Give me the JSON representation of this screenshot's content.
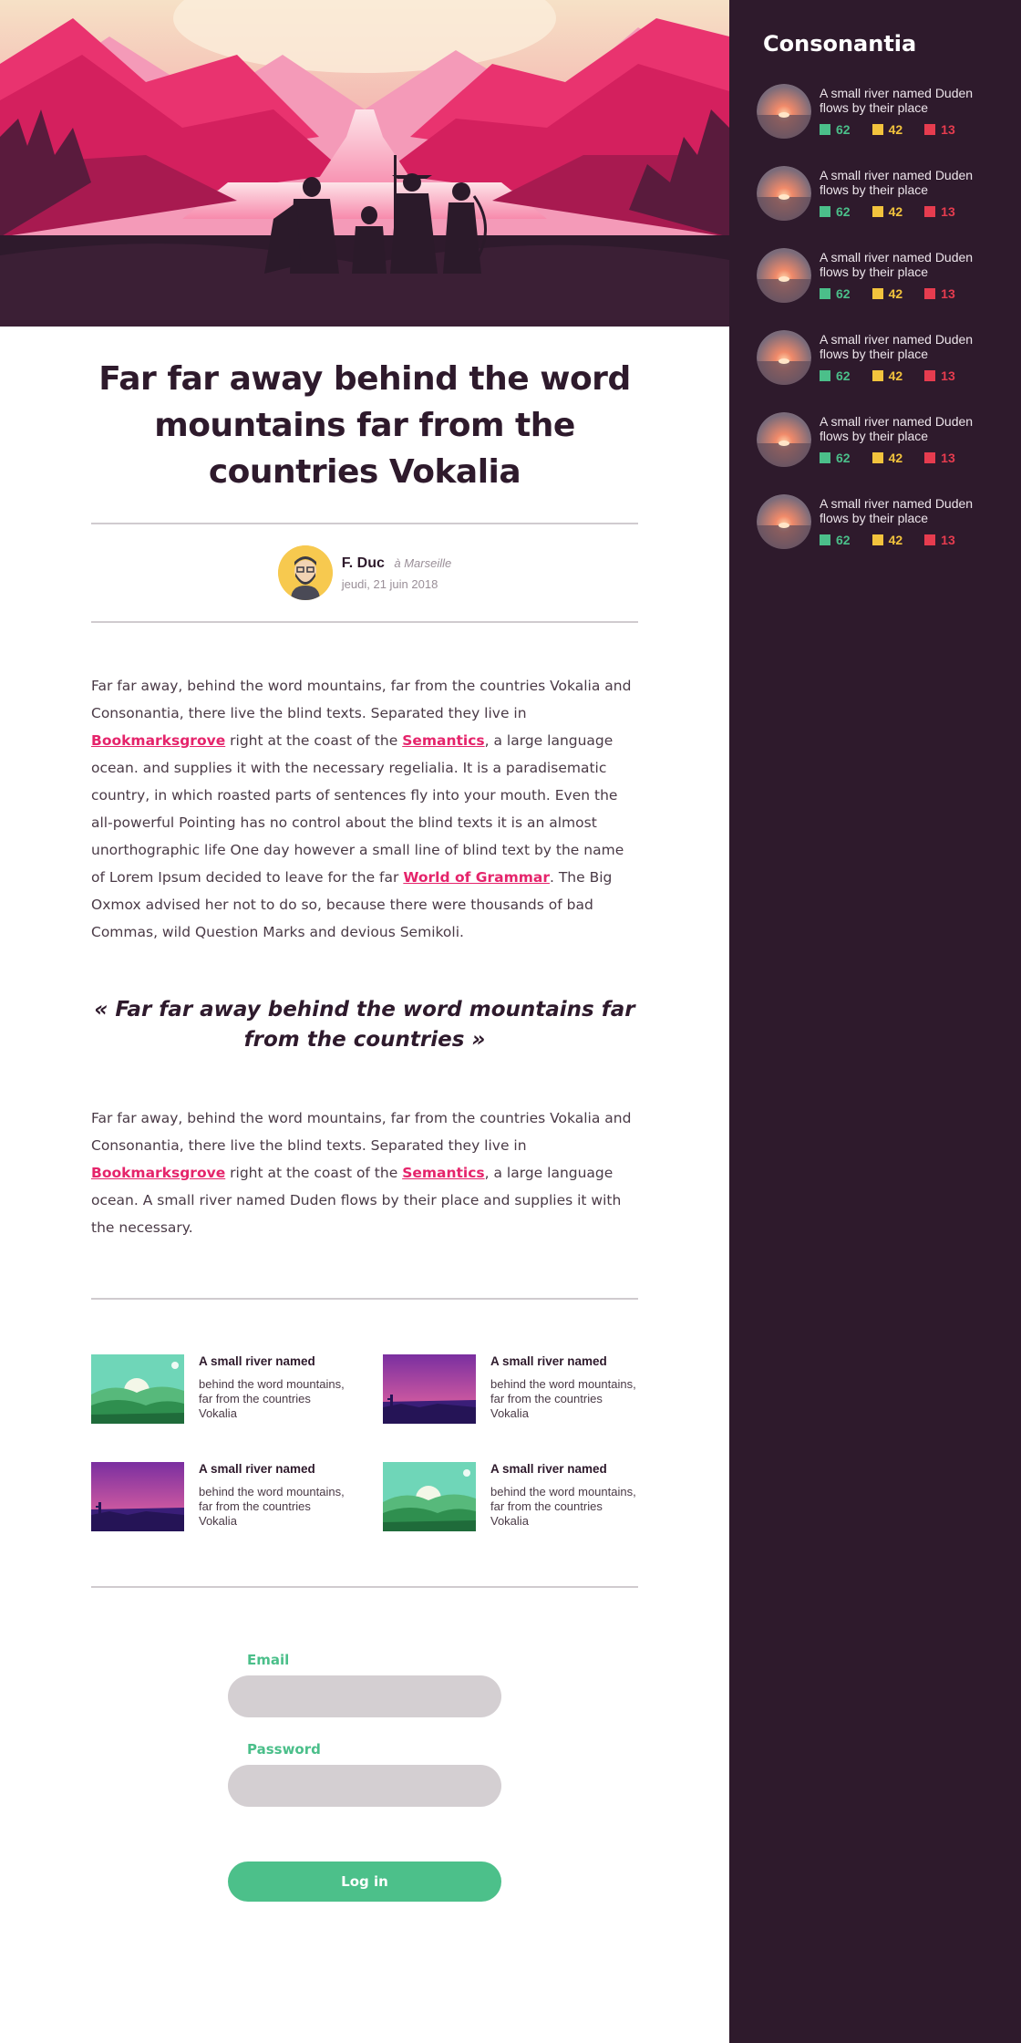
{
  "article": {
    "title": "Far far away behind the word mountains far from the countries Vokalia",
    "author": {
      "name": "F. Duc",
      "place": "à Marseille",
      "date": "jeudi, 21 juin 2018"
    },
    "p1": {
      "s1": "Far far away, behind the word mountains, far from the countries Vokalia and Consonantia, there live the blind texts. Separated they live in ",
      "l1": "Bookmarksgrove",
      "s2": " right at the coast of the ",
      "l2": "Semantics",
      "s3": ", a large language ocean.   and supplies it with the necessary regelialia. It is a paradisematic country, in which roasted parts of sentences fly into your mouth. Even the all-powerful Pointing has no control about the blind texts it is an almost unorthographic life One day however a small line of blind text by the name of Lorem Ipsum decided to leave for the far ",
      "l3": "World of Grammar",
      "s4": ". The Big Oxmox advised her not to do so, because there were thousands of bad Commas, wild Question Marks and devious Semikoli."
    },
    "quote": "« Far far away behind the word mountains far from the countries »",
    "p2": {
      "s1": "Far far away, behind the word mountains, far from the countries Vokalia and Consonantia, there live the blind texts. Separated they live in ",
      "l1": "Bookmarksgrove",
      "s2": " right at the coast of the ",
      "l2": "Semantics",
      "s3": ", a large language ocean. A small river named Duden flows by their place and supplies it with the necessary."
    }
  },
  "related": [
    {
      "title": "A small river named",
      "text": "behind the word mountains, far from the countries Vokalia",
      "scene": "green-hills"
    },
    {
      "title": "A small river named",
      "text": "behind the word mountains, far from the countries Vokalia",
      "scene": "purple-desert"
    },
    {
      "title": "A small river named",
      "text": "behind the word mountains, far from the countries Vokalia",
      "scene": "purple-desert"
    },
    {
      "title": "A small river named",
      "text": "behind the word mountains, far from the countries Vokalia",
      "scene": "green-hills"
    }
  ],
  "login": {
    "email_label": "Email",
    "email_value": "",
    "password_label": "Password",
    "password_value": "",
    "submit_label": "Log in"
  },
  "sidebar": {
    "title": "Consonantia",
    "items": [
      {
        "text": "A small river named Duden flows by their place",
        "green": "62",
        "yellow": "42",
        "red": "13"
      },
      {
        "text": "A small river named Duden flows by their place",
        "green": "62",
        "yellow": "42",
        "red": "13"
      },
      {
        "text": "A small river named Duden flows by their place",
        "green": "62",
        "yellow": "42",
        "red": "13"
      },
      {
        "text": "A small river named Duden flows by their place",
        "green": "62",
        "yellow": "42",
        "red": "13"
      },
      {
        "text": "A small river named Duden flows by their place",
        "green": "62",
        "yellow": "42",
        "red": "13"
      },
      {
        "text": "A small river named Duden flows by their place",
        "green": "62",
        "yellow": "42",
        "red": "13"
      }
    ]
  },
  "colors": {
    "sidebar_bg": "#2e1a2c",
    "link": "#e5246b",
    "green": "#4bbf8a",
    "yellow": "#f2c33d",
    "red": "#e63c4f",
    "dark": "#2e1a2c"
  },
  "icons": {
    "hero": "mountain-valley-illustration",
    "author": "bearded-man-avatar"
  }
}
